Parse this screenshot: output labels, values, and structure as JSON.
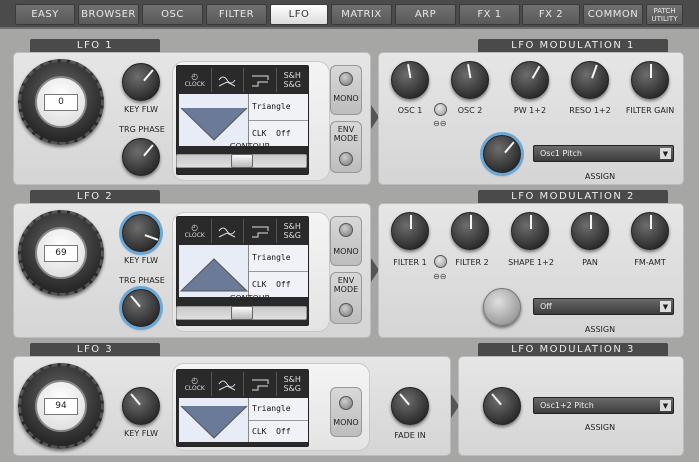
{
  "tabs": [
    {
      "label": "EASY",
      "active": false
    },
    {
      "label": "BROWSER",
      "active": false
    },
    {
      "label": "OSC",
      "active": false
    },
    {
      "label": "FILTER",
      "active": false
    },
    {
      "label": "LFO",
      "active": true
    },
    {
      "label": "MATRIX",
      "active": false
    },
    {
      "label": "ARP",
      "active": false
    },
    {
      "label": "FX 1",
      "active": false
    },
    {
      "label": "FX 2",
      "active": false
    },
    {
      "label": "COMMON",
      "active": false
    }
  ],
  "patch_utility": {
    "line1": "PATCH",
    "line2": "UTILITY"
  },
  "lfo": [
    {
      "title": "LFO 1",
      "rate": "0",
      "key_flw": "KEY FLW",
      "trg_phase": "TRG PHASE",
      "clock": "CLOCK",
      "sh": "S&H",
      "sg": "S&G",
      "shape": "Triangle",
      "clk": "CLK",
      "clk_val": "Off",
      "contour": "CONTOUR",
      "mono": "MONO",
      "env_mode_1": "ENV",
      "env_mode_2": "MODE"
    },
    {
      "title": "LFO 2",
      "rate": "69",
      "key_flw": "KEY FLW",
      "trg_phase": "TRG PHASE",
      "clock": "CLOCK",
      "sh": "S&H",
      "sg": "S&G",
      "shape": "Triangle",
      "clk": "CLK",
      "clk_val": "Off",
      "contour": "CONTOUR",
      "mono": "MONO",
      "env_mode_1": "ENV",
      "env_mode_2": "MODE"
    },
    {
      "title": "LFO 3",
      "rate": "94",
      "key_flw": "KEY FLW",
      "clock": "CLOCK",
      "sh": "S&H",
      "sg": "S&G",
      "shape": "Triangle",
      "clk": "CLK",
      "clk_val": "Off",
      "mono": "MONO",
      "fade_in": "FADE IN"
    }
  ],
  "mod": [
    {
      "title": "LFO MODULATION 1",
      "knobs": [
        "OSC 1",
        "OSC 2",
        "PW 1+2",
        "RESO 1+2",
        "FILTER GAIN"
      ],
      "assign_value": "Osc1 Pitch",
      "assign": "ASSIGN"
    },
    {
      "title": "LFO MODULATION 2",
      "knobs": [
        "FILTER 1",
        "FILTER 2",
        "SHAPE 1+2",
        "PAN",
        "FM-AMT"
      ],
      "assign_value": "Off",
      "assign": "ASSIGN"
    },
    {
      "title": "LFO MODULATION 3",
      "assign_value": "Osc1+2 Pitch",
      "assign": "ASSIGN"
    }
  ],
  "icons": {
    "chevron": "▼",
    "link": "⊕"
  }
}
